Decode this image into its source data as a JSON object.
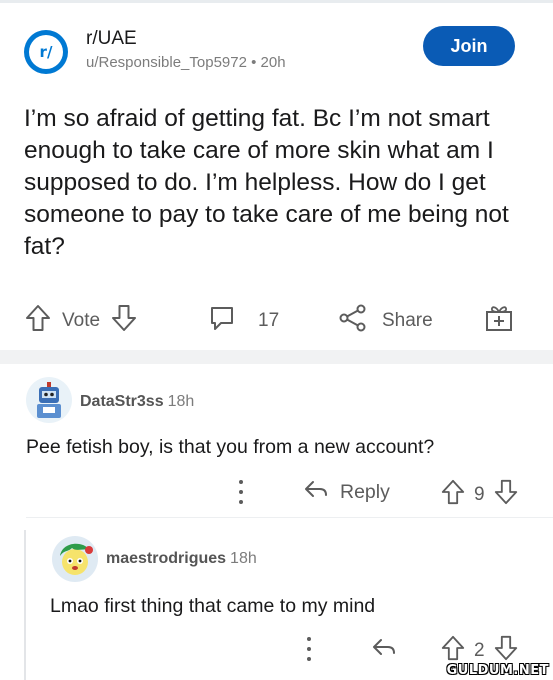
{
  "post": {
    "subreddit": "r/UAE",
    "subreddit_icon_text": "r/",
    "author_meta": "u/Responsible_Top5972 • 20h",
    "join_label": "Join",
    "title": "I’m so afraid of getting fat. Bc I’m not smart enough to take care of more skin what am I supposed to do. I’m helpless. How do I get someone to pay to take care of me being not fat?",
    "vote_label": "Vote",
    "comment_count": "17",
    "share_label": "Share"
  },
  "comments": [
    {
      "username": "DataStr3ss",
      "time": "18h",
      "text": "Pee fetish boy, is that you from a new account?",
      "reply_label": "Reply",
      "score": "9"
    },
    {
      "username": "maestrodrigues",
      "time": "18h",
      "text": "Lmao first thing that came to my mind",
      "score": "2"
    }
  ],
  "watermark": "GULDUM.NET",
  "colors": {
    "accent": "#0a5bb5",
    "subreddit_icon": "#0079d3",
    "meta": "#7c7c7c",
    "action": "#5c5c5c"
  }
}
